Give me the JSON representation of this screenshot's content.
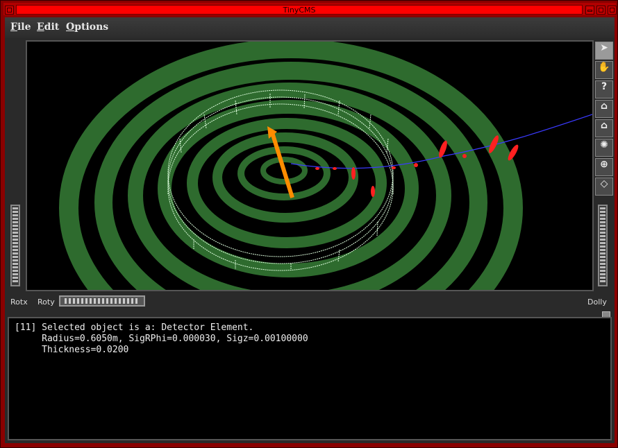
{
  "window": {
    "title": "TinyCMS"
  },
  "menu": {
    "items": [
      {
        "label": "File",
        "u": "F",
        "rest": "ile"
      },
      {
        "label": "Edit",
        "u": "E",
        "rest": "dit"
      },
      {
        "label": "Options",
        "u": "O",
        "rest": "ptions"
      }
    ]
  },
  "toolbar": {
    "icons": [
      "pointer-icon",
      "hand-icon",
      "help-icon",
      "home-icon",
      "set-home-icon",
      "view-all-icon",
      "seek-icon",
      "projection-icon"
    ]
  },
  "controls": {
    "rotx": "Rotx",
    "roty": "Roty",
    "dolly": "Dolly"
  },
  "console": {
    "line1": "[11] Selected object is a: Detector Element.",
    "line2": "     Radius=0.6050m, SigRPhi=0.000030, Sigz=0.00100000",
    "line3": "     Thickness=0.0200"
  },
  "colors": {
    "frame": "#8a0000",
    "title": "#ff0000",
    "rings": "#2e6b2e",
    "selection": "#e0ffe0",
    "track": "#3a3aff",
    "hits": "#ff2020",
    "arrow": "#ff8c00"
  }
}
